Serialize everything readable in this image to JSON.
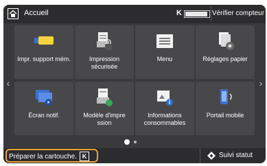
{
  "header": {
    "title": "Accueil",
    "toner_label": "K",
    "toner_level": 0.95,
    "verify_button": "Vérifier compteur"
  },
  "tiles": [
    {
      "label": "Impr. support mém.",
      "icon": "usb-memory-icon"
    },
    {
      "label": "Impression sécurisée",
      "icon": "secure-print-icon"
    },
    {
      "label": "Menu",
      "icon": "menu-icon"
    },
    {
      "label": "Réglages papier",
      "icon": "paper-settings-icon"
    },
    {
      "label": "Écran notif.",
      "icon": "notification-screen-icon"
    },
    {
      "label": "Modèle d'impre ssion",
      "icon": "print-template-icon"
    },
    {
      "label": "Informations consommables",
      "icon": "consumables-info-icon"
    },
    {
      "label": "Portail mobile",
      "icon": "mobile-portal-icon"
    }
  ],
  "pagination": {
    "current": 1,
    "total": 2
  },
  "footer": {
    "message": "Préparer la cartouche.",
    "message_badge": "K",
    "status_button": "Suivi statut"
  },
  "colors": {
    "accent": "#e8a33c",
    "background": "#3a3a3c",
    "tile": "#48484a"
  }
}
